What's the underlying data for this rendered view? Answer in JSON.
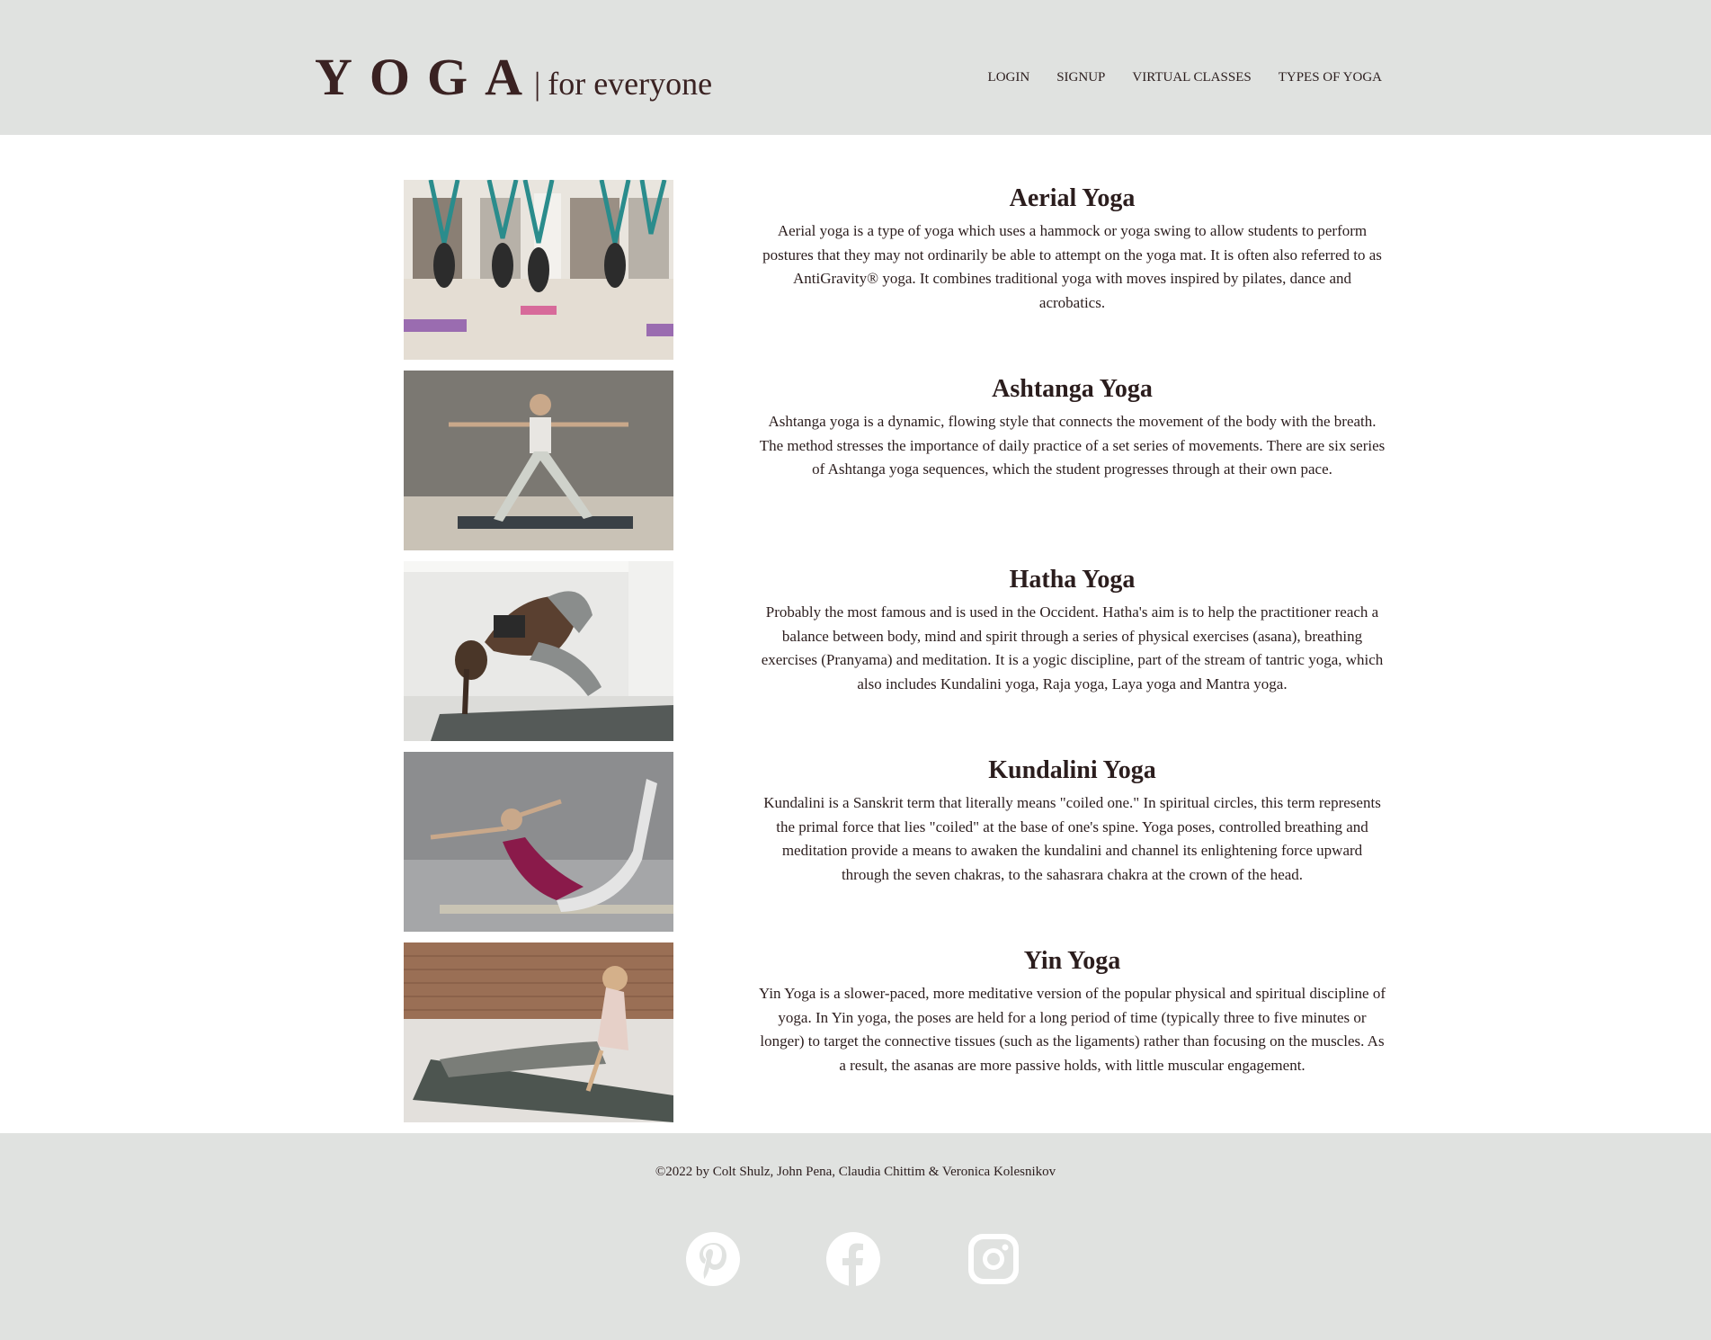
{
  "header": {
    "logo_main": "YOGA",
    "logo_sep": "|",
    "logo_sub": "for everyone",
    "nav": [
      {
        "label": "LOGIN"
      },
      {
        "label": "SIGNUP"
      },
      {
        "label": "VIRTUAL CLASSES"
      },
      {
        "label": "TYPES OF YOGA"
      }
    ]
  },
  "yoga_types": [
    {
      "title": "Aerial Yoga",
      "description": "Aerial yoga is a type of yoga which uses a hammock or yoga swing to allow students to perform postures that they may not ordinarily be able to attempt on the yoga mat. It is often also referred to as AntiGravity® yoga. It combines traditional yoga with moves inspired by pilates, dance and acrobatics."
    },
    {
      "title": "Ashtanga Yoga",
      "description": "Ashtanga yoga is a dynamic, flowing style that connects the movement of the body with the breath. The method stresses the importance of daily practice of a set series of movements. There are six series of Ashtanga yoga sequences, which the student progresses through at their own pace."
    },
    {
      "title": "Hatha Yoga",
      "description": "Probably the most famous and is used in the Occident. Hatha's aim is to help the practitioner reach a balance between body, mind and spirit through a series of physical exercises (asana), breathing exercises (Pranyama) and meditation. It is a yogic discipline, part of the stream of tantric yoga, which also includes Kundalini yoga, Raja yoga, Laya yoga and Mantra yoga."
    },
    {
      "title": "Kundalini Yoga",
      "description": "Kundalini is a Sanskrit term that literally means \"coiled one.\" In spiritual circles, this term represents the primal force that lies \"coiled\" at the base of one's spine. Yoga poses, controlled breathing and meditation provide a means to awaken the kundalini and channel its enlightening force upward through the seven chakras, to the sahasrara chakra at the crown of the head."
    },
    {
      "title": "Yin Yoga",
      "description": "Yin Yoga is a slower-paced, more meditative version of the popular physical and spiritual discipline of yoga. In Yin yoga, the poses are held for a long period of time (typically three to five minutes or longer) to target the connective tissues (such as the ligaments) rather than focusing on the muscles. As a result, the asanas are more passive holds, with little muscular engagement."
    }
  ],
  "footer": {
    "credits": "©2022 by Colt Shulz, John Pena, Claudia Chittim & Veronica Kolesnikov",
    "social": [
      {
        "icon": "pinterest-icon"
      },
      {
        "icon": "facebook-icon"
      },
      {
        "icon": "instagram-icon"
      }
    ]
  },
  "colors": {
    "header_bg": "#e0e2e0",
    "text": "#2b1d1d",
    "icon": "#ffffff"
  }
}
